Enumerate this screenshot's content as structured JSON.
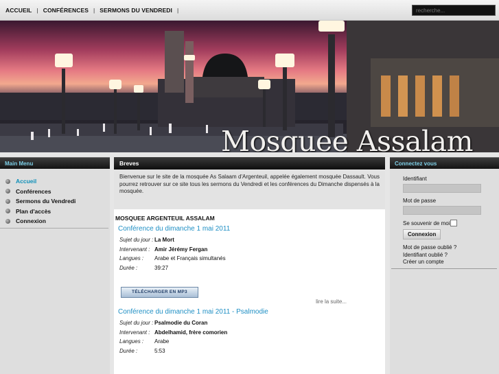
{
  "nav": {
    "items": [
      {
        "label": "ACCUEIL"
      },
      {
        "label": "CONFÉRENCES"
      },
      {
        "label": "SERMONS DU VENDREDI"
      }
    ],
    "separator": "|"
  },
  "search": {
    "placeholder": "recherche..."
  },
  "banner": {
    "title": "Mosquee Assalam"
  },
  "left_menu": {
    "title": "Main Menu",
    "items": [
      {
        "label": "Accueil",
        "active": true
      },
      {
        "label": "Conférences"
      },
      {
        "label": "Sermons du Vendredi"
      },
      {
        "label": "Plan d'accès"
      },
      {
        "label": "Connexion"
      }
    ]
  },
  "breves": {
    "title": "Breves",
    "text": "Bienvenue sur le site de la mosquée As Salaam d'Argenteuil, appelée également mosquée Dassault. Vous pourrez retrouver sur ce site tous les sermons du Vendredi et les conférences du Dimanche dispensés à la mosquée."
  },
  "section_title": "MOSQUEE ARGENTEUIL ASSALAM",
  "articles": [
    {
      "title": "Conférence du dimanche 1 mai 2011",
      "sujet_label": "Sujet du jour :",
      "sujet": "La Mort",
      "intervenant_label": "Intervenant :",
      "intervenant": "Amir Jérémy Fergan",
      "langues_label": "Langues :",
      "langues": "Arabe et Français simultanés",
      "duree_label": "Durée :",
      "duree": "39:27",
      "download_label": "TÉLÉCHARGER EN MP3",
      "read_more": "lire la suite..."
    },
    {
      "title": "Conférence du dimanche 1 mai 2011 - Psalmodie",
      "sujet_label": "Sujet du jour :",
      "sujet": "Psalmodie du Coran",
      "intervenant_label": "Intervenant :",
      "intervenant": "Abdelhamid, frère comorien",
      "langues_label": "Langues :",
      "langues": "Arabe",
      "duree_label": "Durée :",
      "duree": "5:53"
    }
  ],
  "login": {
    "title": "Connectez vous",
    "username_label": "Identifiant",
    "password_label": "Mot de passe",
    "remember_label": "Se souvenir de moi",
    "button_label": "Connexion",
    "links": [
      "Mot de passe oublié ?",
      "Identifiant oublié ?",
      "Créer un compte"
    ]
  },
  "colors": {
    "accent": "#1f8fc4",
    "panel_title": "#7fd0e8",
    "menu_active": "#0e8fb8"
  },
  "icons": {
    "menu_bullet": "bullet-icon"
  }
}
